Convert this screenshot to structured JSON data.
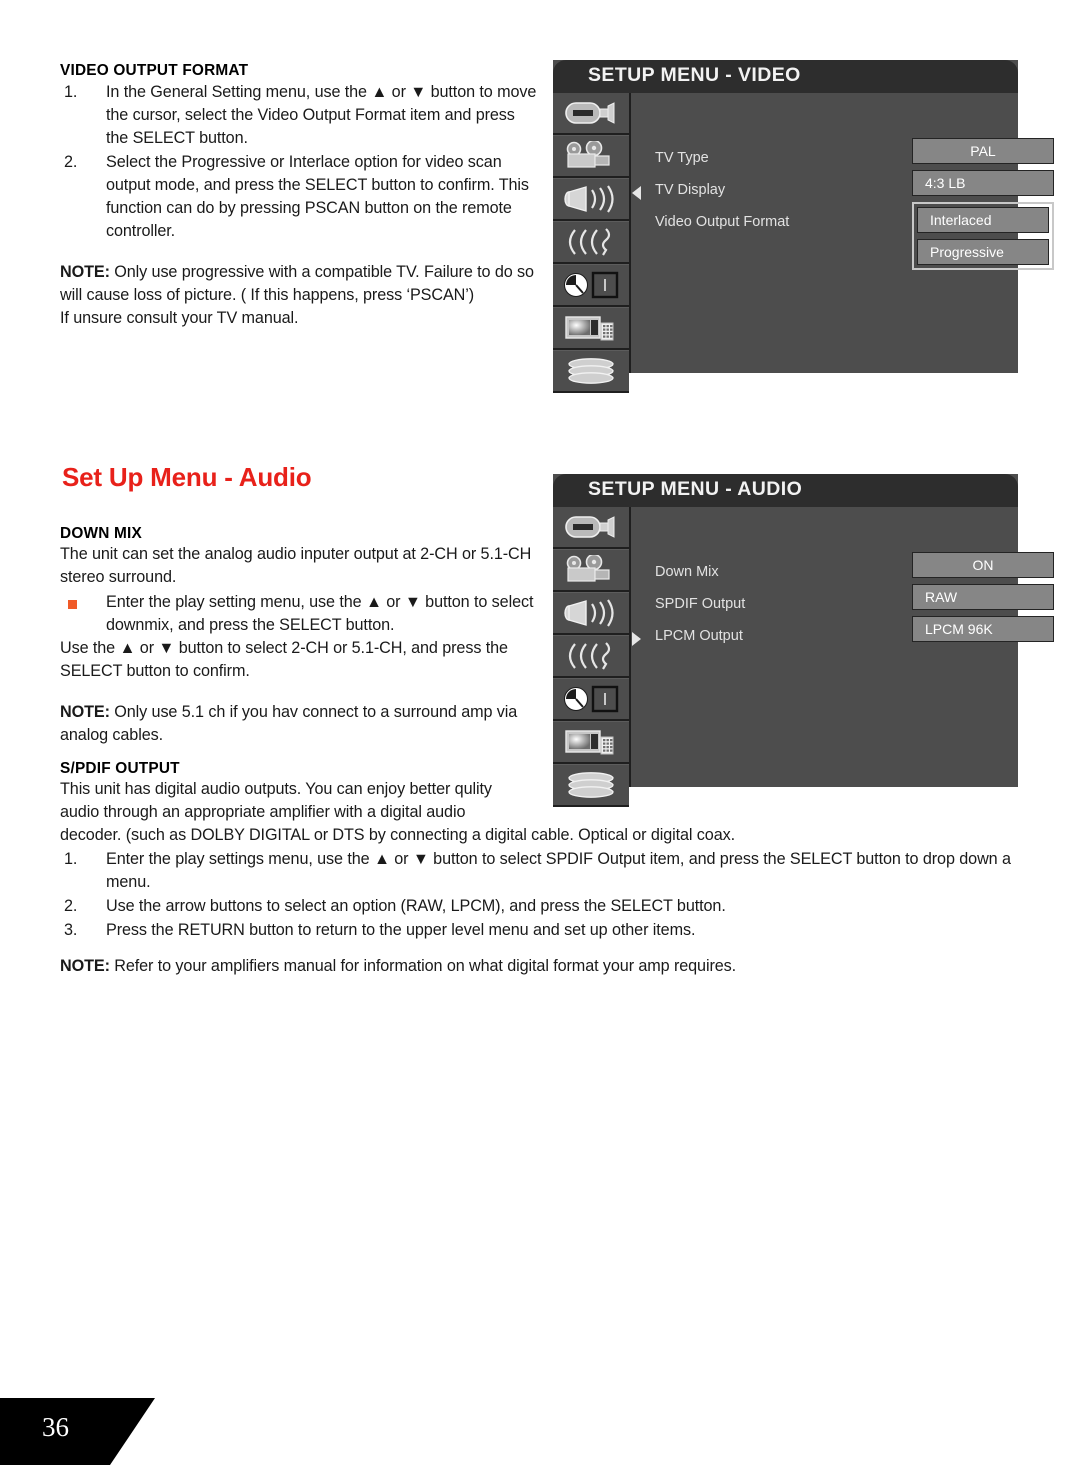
{
  "page": {
    "number": "36"
  },
  "video_format_section": {
    "heading": "VIDEO OUTPUT FORMAT",
    "steps": [
      {
        "num": "1.",
        "text": "In the General Setting menu, use the ▲ or ▼ button to move the cursor, select the Video Output Format item and press the SELECT button."
      },
      {
        "num": "2.",
        "text": "Select the Progressive or Interlace option for video scan output mode, and press the SELECT button to confirm. This function can do by pressing PSCAN button on the remote controller."
      }
    ],
    "note_label": "NOTE:",
    "note_text": " Only use progressive with a compatible TV. Failure to do so will cause loss of picture. ( If this happens, press ‘PSCAN’)",
    "note_text2": "If unsure consult your TV manual."
  },
  "audio_heading": "Set Up Menu - Audio",
  "downmix_section": {
    "heading": "DOWN MIX",
    "intro": "The unit can set the analog audio inputer output at 2-CH or 5.1-CH stereo surround.",
    "bullet": "Enter the play setting menu, use the ▲ or ▼ button to select downmix, and press the SELECT button.",
    "after": "Use the ▲ or ▼ button to select 2-CH or 5.1-CH, and press the SELECT button to confirm.",
    "note_label": "NOTE:",
    "note_text": " Only use 5.1 ch if you hav connect to a surround amp via analog cables."
  },
  "spdif_section": {
    "heading": "S/PDIF OUTPUT",
    "intro": "This unit has digital audio outputs. You can enjoy better qulity audio through an appropriate amplifier with a digital audio",
    "intro2": "decoder. (such as DOLBY DIGITAL or DTS by connecting a digital cable. Optical or digital coax.",
    "steps": [
      {
        "num": "1.",
        "text": "Enter the play settings menu, use the ▲ or ▼ button to select SPDIF Output item, and press the SELECT button to drop down a menu."
      },
      {
        "num": "2.",
        "text": "Use the arrow buttons to select an option (RAW, LPCM), and press the SELECT button."
      },
      {
        "num": "3.",
        "text": "Press the RETURN button to return to the upper level menu and set up other items."
      }
    ]
  },
  "final_note": {
    "label": "NOTE:",
    "text": " Refer to your amplifiers manual for information on what digital format your amp requires."
  },
  "osd_video": {
    "title": "SETUP MENU - VIDEO",
    "icons": [
      "projector-icon",
      "movie-camera-icon",
      "speaker-icon",
      "sound-waves-icon",
      "clock-icon",
      "monitor-remote-icon",
      "disc-stack-icon"
    ],
    "active_icon_index": 1,
    "rows": [
      {
        "label": "TV Type",
        "arrow": "none"
      },
      {
        "label": "TV Display",
        "arrow": "left"
      },
      {
        "label": "Video Output Format",
        "arrow": "none"
      }
    ],
    "values": [
      {
        "text": "PAL",
        "align": "center",
        "grouped": false
      },
      {
        "text": "4:3 LB",
        "align": "left",
        "grouped": false
      },
      {
        "text": "Interlaced",
        "align": "left",
        "grouped": true
      },
      {
        "text": "Progressive",
        "align": "left",
        "grouped": true
      }
    ]
  },
  "osd_audio": {
    "title": "SETUP MENU - AUDIO",
    "icons": [
      "projector-icon",
      "movie-camera-icon",
      "speaker-icon",
      "sound-waves-icon",
      "clock-icon",
      "monitor-remote-icon",
      "disc-stack-icon"
    ],
    "active_icon_index": 2,
    "rows": [
      {
        "label": "Down Mix",
        "arrow": "none"
      },
      {
        "label": "SPDIF Output",
        "arrow": "none"
      },
      {
        "label": "LPCM Output",
        "arrow": "right"
      }
    ],
    "values": [
      {
        "text": "ON",
        "align": "center",
        "grouped": false
      },
      {
        "text": "RAW",
        "align": "left",
        "grouped": false
      },
      {
        "text": "LPCM 96K",
        "align": "left",
        "grouped": false
      }
    ]
  },
  "colors": {
    "accent_red": "#e8211a",
    "bullet_orange": "#f05a28",
    "osd_body": "#4d4d4d",
    "osd_titlebar": "#2d2d2d",
    "osd_button": "#868686",
    "osd_highlight_border": "#c8c8c8"
  }
}
